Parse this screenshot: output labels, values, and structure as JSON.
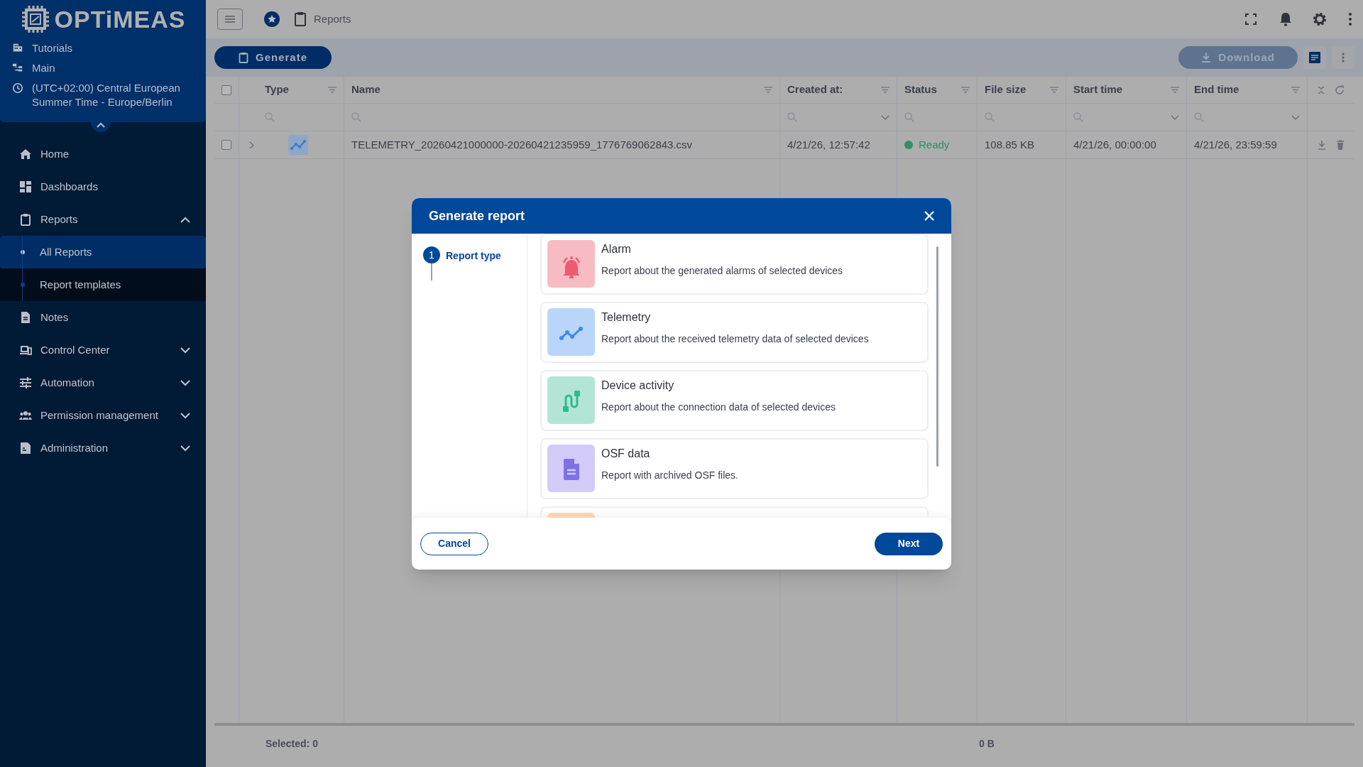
{
  "sidebar": {
    "logo": "OPTiMEAS",
    "context": [
      {
        "kind": "building",
        "text": "Tutorials"
      },
      {
        "kind": "tree",
        "text": "Main"
      },
      {
        "kind": "clock",
        "text": "(UTC+02:00) Central European Summer Time - Europe/Berlin"
      }
    ],
    "items": [
      {
        "kind": "home",
        "label": "Home"
      },
      {
        "kind": "dashboard",
        "label": "Dashboards"
      },
      {
        "kind": "clipboard",
        "label": "Reports",
        "expanded": true,
        "children": [
          {
            "label": "All Reports",
            "selected": true
          },
          {
            "label": "Report templates",
            "selected": false
          }
        ]
      },
      {
        "kind": "note",
        "label": "Notes"
      },
      {
        "kind": "devices",
        "label": "Control Center",
        "expanded": false
      },
      {
        "kind": "sliders",
        "label": "Automation",
        "expanded": false
      },
      {
        "kind": "people",
        "label": "Permission management",
        "expanded": false
      },
      {
        "kind": "admin",
        "label": "Administration",
        "expanded": false
      }
    ]
  },
  "top_bar": {
    "breadcrumb": "Reports"
  },
  "toolbar": {
    "generate": "Generate",
    "download": "Download"
  },
  "table": {
    "select_all_checked": false,
    "columns": [
      {
        "label": "Type",
        "dropdown": false
      },
      {
        "label": "Name",
        "dropdown": false
      },
      {
        "label": "Created at:",
        "dropdown": true
      },
      {
        "label": "Status",
        "dropdown": false
      },
      {
        "label": "File size",
        "dropdown": false
      },
      {
        "label": "Start time",
        "dropdown": true
      },
      {
        "label": "End time",
        "dropdown": true
      }
    ],
    "rows": [
      {
        "checked": false,
        "name": "TELEMETRY_20260421000000-20260421235959_1776769062843.csv",
        "created": "4/21/26, 12:57:42",
        "status": "Ready",
        "color": "#2f8f6a",
        "size": "108.85 KB",
        "start": "4/21/26, 00:00:00",
        "end": "4/21/26, 23:59:59"
      }
    ],
    "footer": {
      "selected": "Selected: 0",
      "total": "0 B"
    }
  },
  "dialog": {
    "title": "Generate report",
    "steps": [
      {
        "number": "1",
        "label": "Report type",
        "selected": true
      }
    ],
    "options": [
      {
        "kind": "bell",
        "title": "Alarm",
        "description": "Report about the generated alarms of selected devices",
        "color": "#f7bcc3"
      },
      {
        "kind": "chart",
        "title": "Telemetry",
        "description": "Report about the received telemetry data of selected devices",
        "color": "#b9d6fa"
      },
      {
        "kind": "plug",
        "title": "Device activity",
        "description": "Report about the connection data of selected devices",
        "color": "#b3e5d6"
      },
      {
        "kind": "document",
        "title": "OSF data",
        "description": "Report with archived OSF files.",
        "color": "#d3cbf7"
      },
      {
        "kind": "unknown",
        "color": "#fbd2b5"
      }
    ],
    "cancel": "Cancel",
    "next": "Next"
  }
}
